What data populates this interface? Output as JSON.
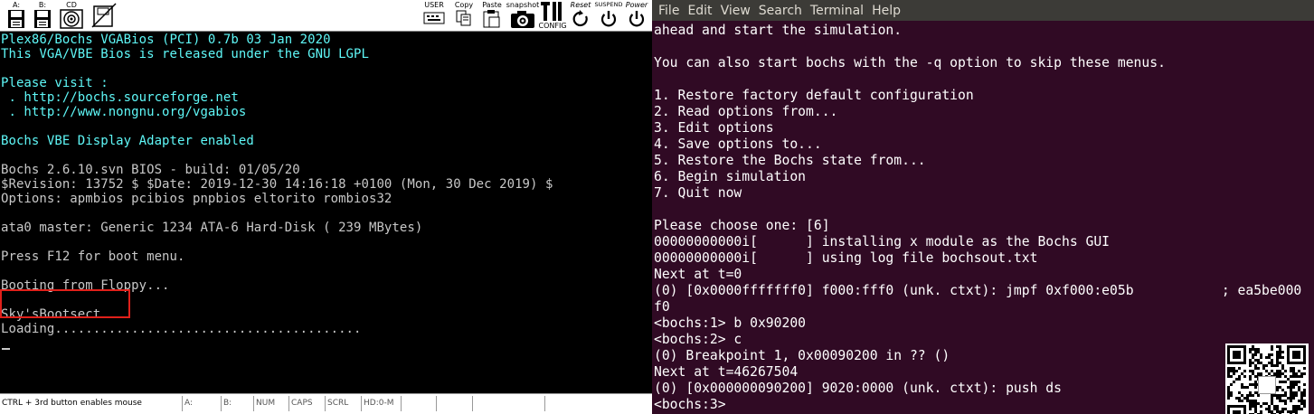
{
  "bochs": {
    "toolbar": [
      {
        "label": "A:",
        "icon": "floppy-a-icon"
      },
      {
        "label": "B:",
        "icon": "floppy-b-icon"
      },
      {
        "label": "CD",
        "icon": "cdrom-icon"
      },
      {
        "label": "",
        "icon": "floppy-disabled-icon"
      },
      {
        "label": "USER",
        "icon": "user-icon"
      },
      {
        "label": "Copy",
        "icon": "copy-icon"
      },
      {
        "label": "Paste",
        "icon": "paste-icon"
      },
      {
        "label": "snapshot",
        "icon": "snapshot-icon"
      },
      {
        "label": "CONFIG",
        "icon": "config-icon"
      },
      {
        "label": "Reset",
        "icon": "reset-icon"
      },
      {
        "label": "SUSPEND",
        "icon": "suspend-icon"
      },
      {
        "label": "Power",
        "icon": "power-icon"
      }
    ],
    "screen_lines": [
      {
        "text": "Plex86/Bochs VGABios (PCI) 0.7b 03 Jan 2020",
        "color": "cyan"
      },
      {
        "text": "This VGA/VBE Bios is released under the GNU LGPL",
        "color": "cyan"
      },
      {
        "text": "",
        "color": "cyan"
      },
      {
        "text": "Please visit :",
        "color": "cyan"
      },
      {
        "text": " . http://bochs.sourceforge.net",
        "color": "cyan"
      },
      {
        "text": " . http://www.nongnu.org/vgabios",
        "color": "cyan"
      },
      {
        "text": "",
        "color": "cyan"
      },
      {
        "text": "Bochs VBE Display Adapter enabled",
        "color": "cyan"
      },
      {
        "text": "",
        "color": "grey"
      },
      {
        "text": "Bochs 2.6.10.svn BIOS - build: 01/05/20",
        "color": "grey"
      },
      {
        "text": "$Revision: 13752 $ $Date: 2019-12-30 14:16:18 +0100 (Mon, 30 Dec 2019) $",
        "color": "grey"
      },
      {
        "text": "Options: apmbios pcibios pnpbios eltorito rombios32",
        "color": "grey"
      },
      {
        "text": "",
        "color": "grey"
      },
      {
        "text": "ata0 master: Generic 1234 ATA-6 Hard-Disk ( 239 MBytes)",
        "color": "grey"
      },
      {
        "text": "",
        "color": "grey"
      },
      {
        "text": "Press F12 for boot menu.",
        "color": "grey"
      },
      {
        "text": "",
        "color": "grey"
      },
      {
        "text": "Booting from Floppy...",
        "color": "grey"
      },
      {
        "text": "",
        "color": "grey"
      },
      {
        "text": "Sky'sBootsect",
        "color": "grey"
      },
      {
        "text": "Loading........................................",
        "color": "grey"
      }
    ],
    "status": [
      {
        "text": "CTRL + 3rd button enables mouse"
      },
      {
        "text": "A:"
      },
      {
        "text": "B:"
      },
      {
        "text": "NUM"
      },
      {
        "text": "CAPS"
      },
      {
        "text": "SCRL"
      },
      {
        "text": "HD:0-M"
      },
      {
        "text": ""
      },
      {
        "text": ""
      },
      {
        "text": ""
      },
      {
        "text": ""
      }
    ]
  },
  "terminal": {
    "menu": [
      "File",
      "Edit",
      "View",
      "Search",
      "Terminal",
      "Help"
    ],
    "lines": [
      "ahead and start the simulation.",
      "",
      "You can also start bochs with the -q option to skip these menus.",
      "",
      "1. Restore factory default configuration",
      "2. Read options from...",
      "3. Edit options",
      "4. Save options to...",
      "5. Restore the Bochs state from...",
      "6. Begin simulation",
      "7. Quit now",
      "",
      "Please choose one: [6]",
      "00000000000i[      ] installing x module as the Bochs GUI",
      "00000000000i[      ] using log file bochsout.txt",
      "Next at t=0",
      "(0) [0x0000fffffff0] f000:fff0 (unk. ctxt): jmpf 0xf000:e05b           ; ea5be000",
      "f0",
      "<bochs:1> b 0x90200",
      "<bochs:2> c",
      "(0) Breakpoint 1, 0x00090200 in ?? ()",
      "Next at t=46267504",
      "(0) [0x000000090200] 9020:0000 (unk. ctxt): push ds",
      "<bochs:3>"
    ]
  },
  "colors": {
    "vga_cyan": "#5ff8f8",
    "vga_grey": "#c8c8c8",
    "terminal_bg": "#300a24",
    "highlight": "#e0201a"
  }
}
